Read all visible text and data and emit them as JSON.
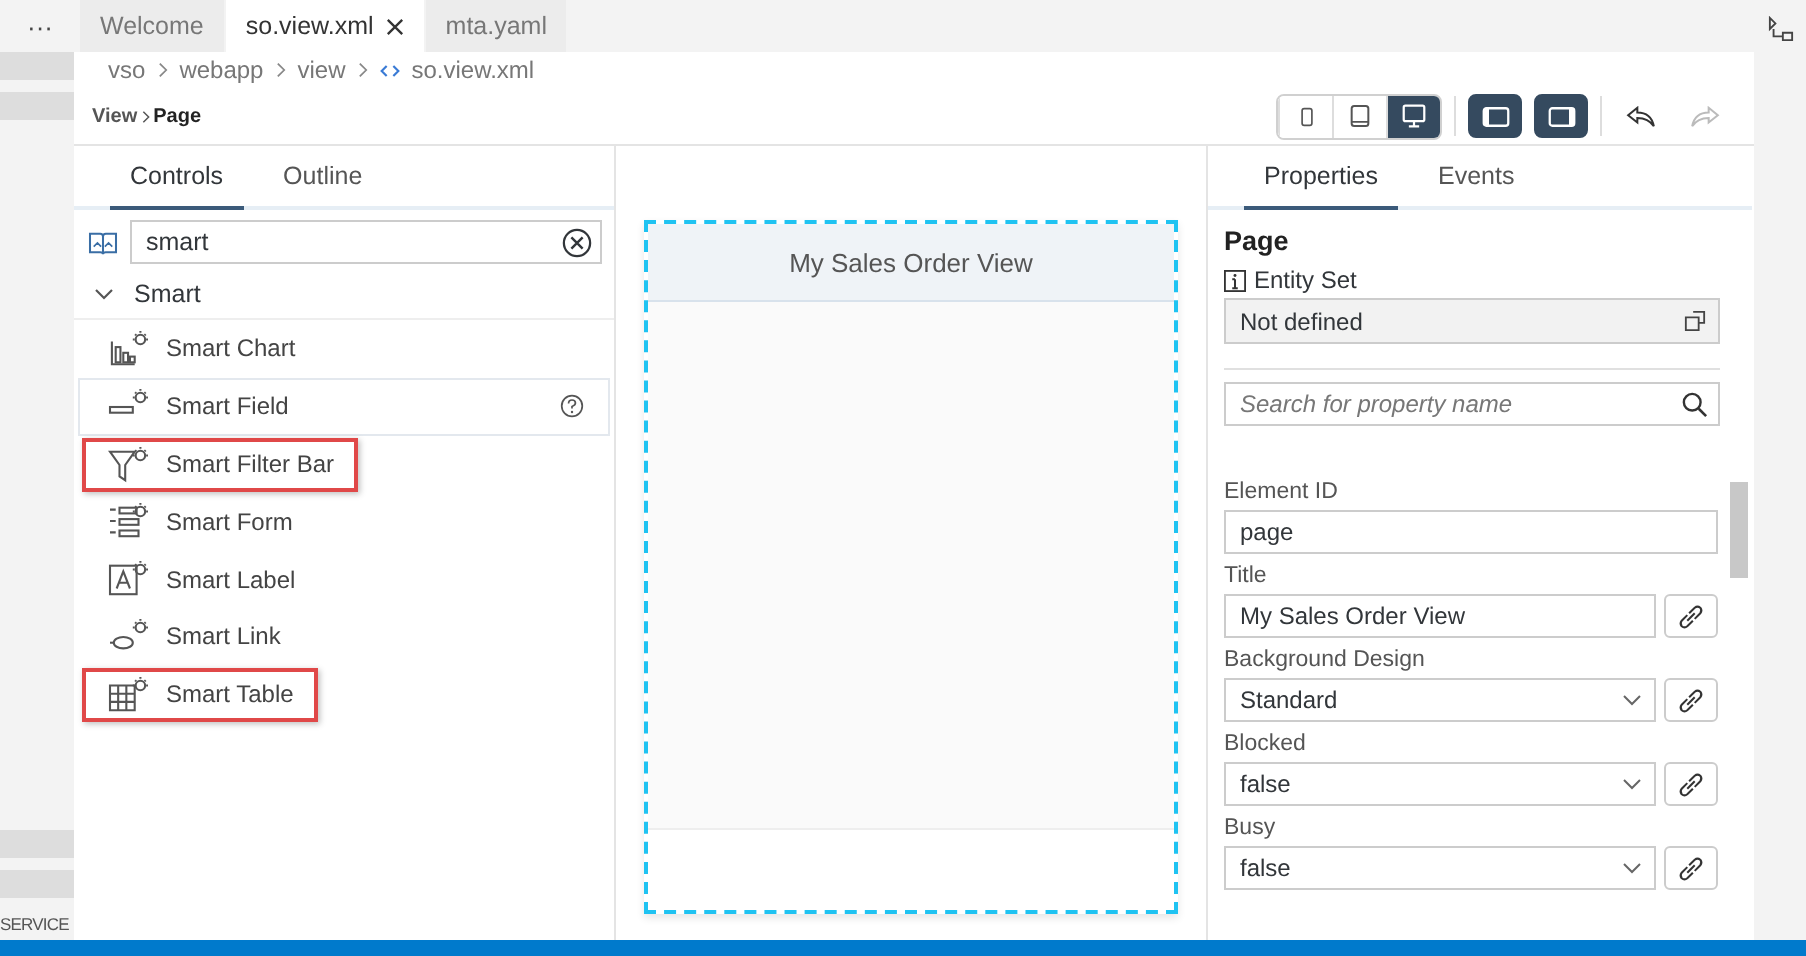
{
  "editor_tabs": [
    {
      "label": "Welcome",
      "selected": false,
      "closable": false
    },
    {
      "label": "so.view.xml",
      "selected": true,
      "closable": true
    },
    {
      "label": "mta.yaml",
      "selected": false,
      "closable": false
    }
  ],
  "overflow_menu": "···",
  "breadcrumb": [
    {
      "label": "vso",
      "kind": "folder"
    },
    {
      "label": "webapp",
      "kind": "folder"
    },
    {
      "label": "view",
      "kind": "folder"
    },
    {
      "label": "so.view.xml",
      "kind": "file"
    }
  ],
  "view_path": {
    "parent": "View",
    "current": "Page"
  },
  "device_buttons": [
    {
      "kind": "phone",
      "selected": false
    },
    {
      "kind": "tablet",
      "selected": false
    },
    {
      "kind": "desktop",
      "selected": true
    }
  ],
  "panel_toggles": [
    {
      "kind": "left",
      "on": true
    },
    {
      "kind": "right",
      "on": true
    }
  ],
  "history": [
    {
      "kind": "undo",
      "disabled": false
    },
    {
      "kind": "redo",
      "disabled": true
    }
  ],
  "left_panel": {
    "tabs": [
      {
        "label": "Controls",
        "selected": true
      },
      {
        "label": "Outline",
        "selected": false
      }
    ],
    "search": {
      "value": "smart"
    },
    "group": {
      "label": "Smart",
      "expanded": true
    },
    "items": [
      {
        "label": "Smart Chart",
        "kind": "chart",
        "hovered": false,
        "highlighted": false
      },
      {
        "label": "Smart Field",
        "kind": "field",
        "hovered": true,
        "highlighted": false
      },
      {
        "label": "Smart Filter Bar",
        "kind": "filter",
        "hovered": false,
        "highlighted": true
      },
      {
        "label": "Smart Form",
        "kind": "form",
        "hovered": false,
        "highlighted": false
      },
      {
        "label": "Smart Label",
        "kind": "label",
        "hovered": false,
        "highlighted": false
      },
      {
        "label": "Smart Link",
        "kind": "link",
        "hovered": false,
        "highlighted": false
      },
      {
        "label": "Smart Table",
        "kind": "table",
        "hovered": false,
        "highlighted": true
      }
    ]
  },
  "canvas": {
    "page_title": "My Sales Order View"
  },
  "right_panel": {
    "tabs": [
      {
        "label": "Properties",
        "selected": true
      },
      {
        "label": "Events",
        "selected": false
      }
    ],
    "heading": "Page",
    "entity_set": {
      "label": "Entity Set",
      "value": "Not defined"
    },
    "search": {
      "placeholder": "Search for property name"
    },
    "properties": [
      {
        "label": "Element ID",
        "kind": "input",
        "value": "page",
        "bindable": false
      },
      {
        "label": "Title",
        "kind": "input",
        "value": "My Sales Order View",
        "bindable": true
      },
      {
        "label": "Background Design",
        "kind": "select",
        "value": "Standard",
        "bindable": true
      },
      {
        "label": "Blocked",
        "kind": "select",
        "value": "false",
        "bindable": true
      },
      {
        "label": "Busy",
        "kind": "select",
        "value": "false",
        "bindable": true
      }
    ]
  },
  "side_strip": {
    "label": "SERVICE"
  }
}
